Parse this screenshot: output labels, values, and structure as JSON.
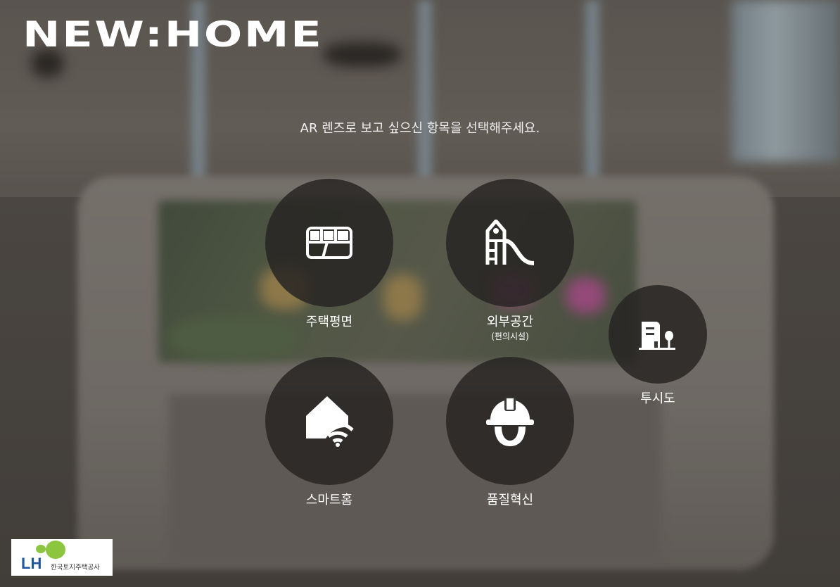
{
  "brand": {
    "logo_text": "NEW:HOME"
  },
  "prompt": "AR 렌즈로 보고 싶으신  항목을 선택해주세요.",
  "menu": {
    "housing_floorplan": {
      "label": "주택평면",
      "icon": "floorplan-icon"
    },
    "outdoor_space": {
      "label": "외부공간",
      "sublabel": "(편의시설)",
      "icon": "playground-slide-icon"
    },
    "perspective_view": {
      "label": "투시도",
      "icon": "building-tree-icon"
    },
    "smart_home": {
      "label": "스마트홈",
      "icon": "smart-home-wifi-icon"
    },
    "quality_innovation": {
      "label": "품질혁신",
      "icon": "hard-hat-icon"
    }
  },
  "footer": {
    "org_logo_text": "LH",
    "org_name": "한국토지주택공사"
  },
  "colors": {
    "button_bg": "#262423",
    "text": "#ffffff",
    "lh_blue": "#1f55a3",
    "lh_green": "#8cc63f"
  }
}
